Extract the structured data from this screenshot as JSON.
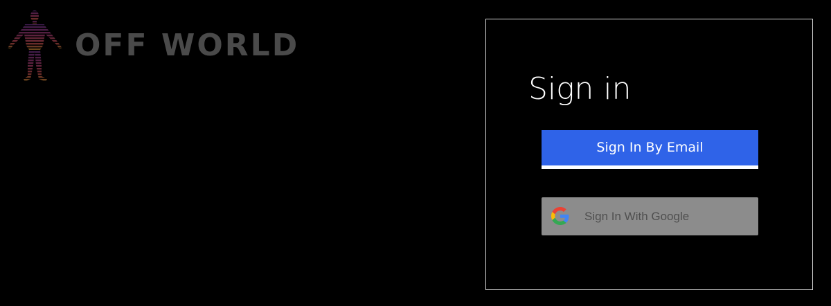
{
  "brand": {
    "name": "OFF WORLD",
    "text_color": "#4a4a4a",
    "logo_icon": "humanoid-figure-icon"
  },
  "signin": {
    "title": "Sign in",
    "email_button_label": "Sign In By Email",
    "google_button_label": "Sign In With Google",
    "email_button_color": "#2f63e8",
    "google_button_color": "#8c8c8c",
    "google_icon": "google-g-icon",
    "panel_border_color": "#d6d6d6"
  }
}
